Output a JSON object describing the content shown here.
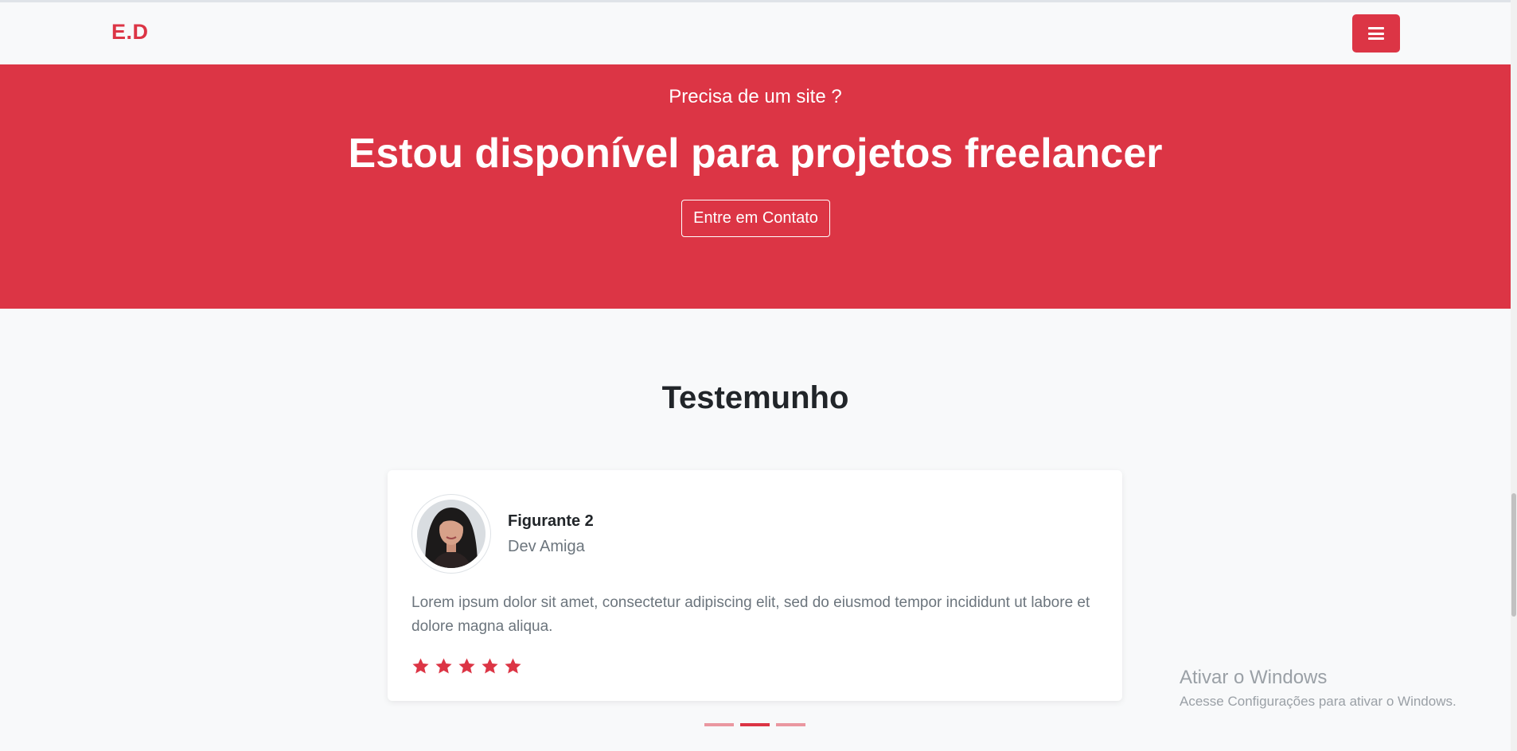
{
  "navbar": {
    "brand": "E.D",
    "menu_icon": "hamburger-menu-icon"
  },
  "hero": {
    "subtitle": "Precisa de um site ?",
    "title": "Estou disponível para projetos freelancer",
    "cta_label": "Entre em Contato"
  },
  "testimonials": {
    "section_title": "Testemunho",
    "active_index": 1,
    "slides_count": 3,
    "current": {
      "name": "Figurante 2",
      "role": "Dev Amiga",
      "text": "Lorem ipsum dolor sit amet, consectetur adipiscing elit, sed do eiusmod tempor incididunt ut labore et dolore magna aliqua.",
      "rating": 5,
      "star_icon": "star-icon"
    }
  },
  "windows_watermark": {
    "title": "Ativar o Windows",
    "subtitle": "Acesse Configurações para ativar o Windows."
  },
  "colors": {
    "accent": "#dc3545",
    "background": "#f8f9fa",
    "text_dark": "#212529",
    "text_muted": "#6c757d"
  }
}
